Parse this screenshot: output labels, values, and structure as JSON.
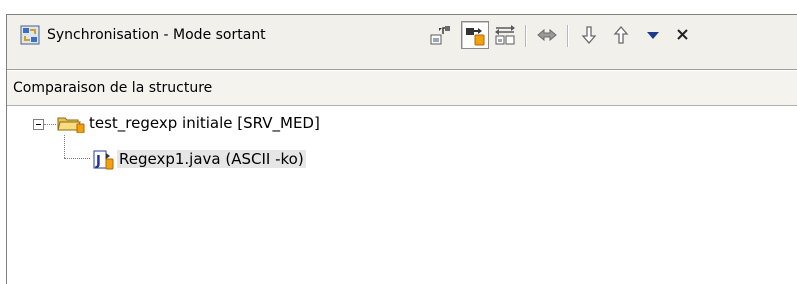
{
  "view": {
    "title": "Synchronisation - Mode sortant",
    "icon": "synchronize-view-icon",
    "toolbar": [
      {
        "name": "incoming-mode-icon",
        "label": "",
        "pressed": false
      },
      {
        "name": "outgoing-mode-icon",
        "label": "",
        "pressed": true
      },
      {
        "name": "incoming-outgoing-mode-icon",
        "label": "",
        "pressed": false
      },
      {
        "name": "conflicts-mode-icon",
        "label": "",
        "pressed": false
      },
      {
        "name": "next-difference-icon",
        "label": "",
        "pressed": false
      },
      {
        "name": "previous-difference-icon",
        "label": "",
        "pressed": false
      },
      {
        "name": "view-menu-icon",
        "label": "",
        "pressed": false
      },
      {
        "name": "close-icon",
        "label": "",
        "pressed": false
      }
    ]
  },
  "compare": {
    "title": "Comparaison de la structure"
  },
  "tree": {
    "project": {
      "label": "test_regexp  initiale [SRV_MED]",
      "icon": "project-folder-outgoing-icon",
      "expanded": true
    },
    "file": {
      "label": "Regexp1.java    (ASCII -ko)",
      "icon": "java-file-outgoing-icon",
      "selected": true
    }
  }
}
